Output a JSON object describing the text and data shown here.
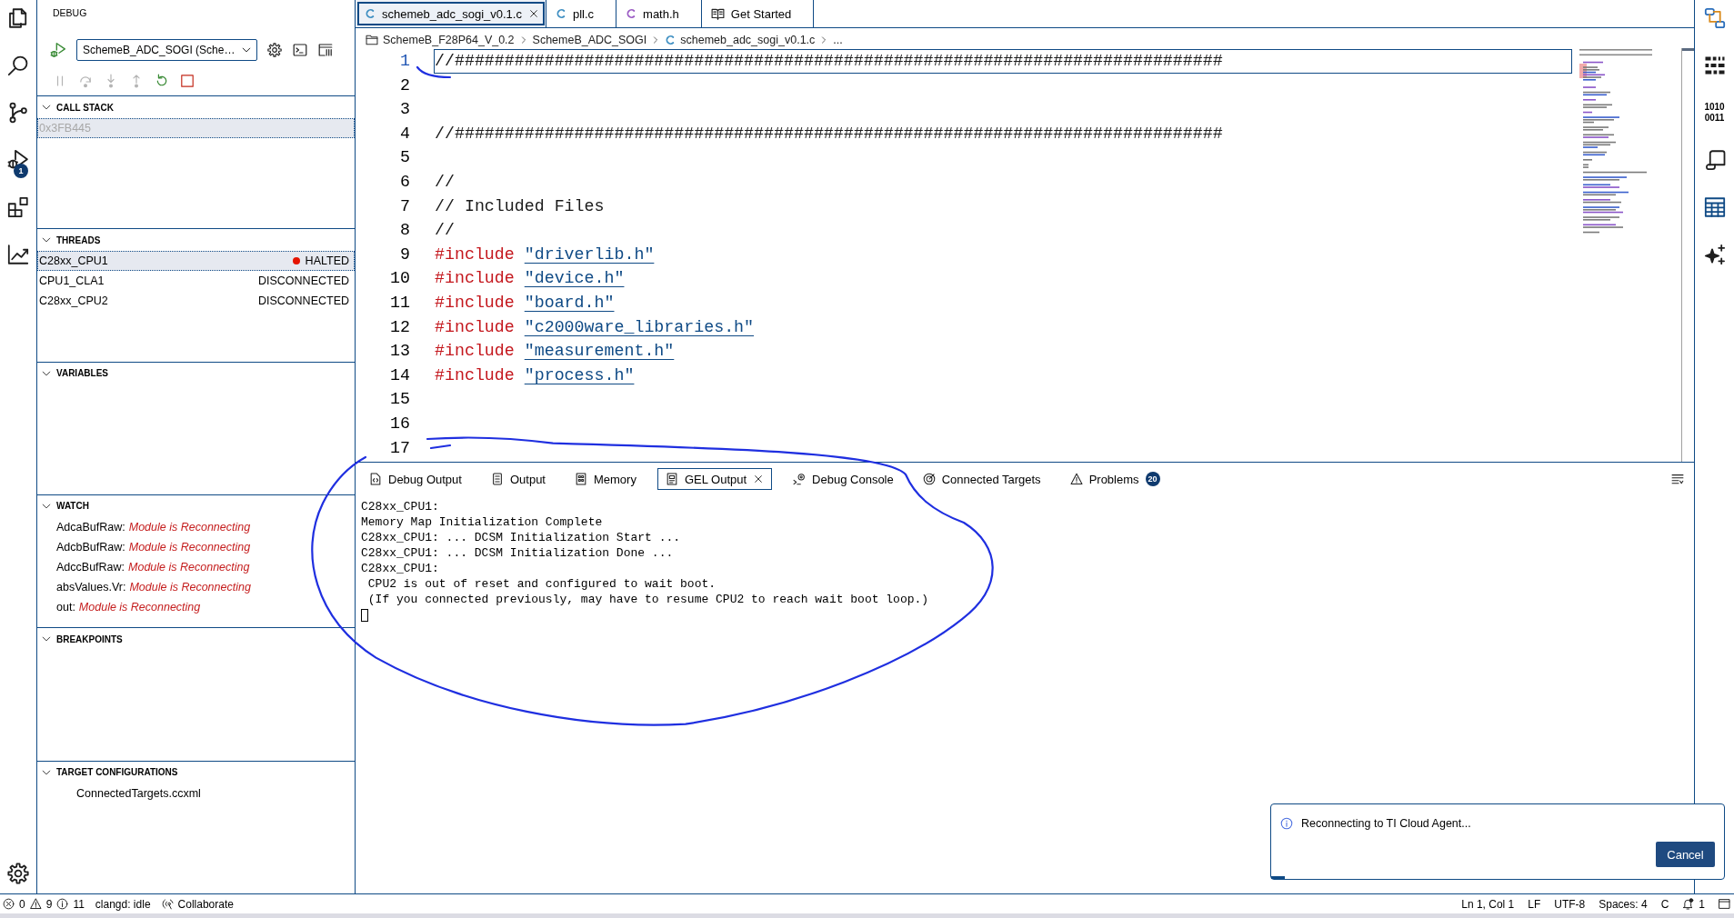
{
  "activity_bar": {
    "debug_badge": "1"
  },
  "sidebar": {
    "title": "DEBUG",
    "launch_config": "SchemeB_ADC_SOGI (Sche…",
    "controls": [
      {
        "disabled": true
      },
      {
        "disabled": true
      },
      {
        "disabled": true
      },
      {
        "disabled": true
      },
      {
        "disabled": false
      },
      {
        "disabled": false
      }
    ],
    "sections": [
      {
        "kind": "call_stack",
        "title": "CALL STACK",
        "expanded": true,
        "rows": [
          {
            "label": "0x3FB445",
            "selected": true,
            "disabled": true
          }
        ]
      },
      {
        "kind": "threads",
        "title": "THREADS",
        "expanded": true,
        "rows": [
          {
            "name": "C28xx_CPU1",
            "status": "HALTED",
            "halted": true,
            "selected": true
          },
          {
            "name": "CPU1_CLA1",
            "status": "DISCONNECTED",
            "halted": false,
            "selected": false
          },
          {
            "name": "C28xx_CPU2",
            "status": "DISCONNECTED",
            "halted": false,
            "selected": false
          }
        ]
      },
      {
        "kind": "variables",
        "title": "VARIABLES",
        "expanded": true
      },
      {
        "kind": "watch",
        "title": "WATCH",
        "expanded": true,
        "rows": [
          {
            "expression": "AdcaBufRaw:",
            "value": "Module is Reconnecting",
            "error": true
          },
          {
            "expression": "AdcbBufRaw:",
            "value": "Module is Reconnecting",
            "error": true
          },
          {
            "expression": "AdccBufRaw:",
            "value": "Module is Reconnecting",
            "error": true
          },
          {
            "expression": "absValues.Vr:",
            "value": "Module is Reconnecting",
            "error": true
          },
          {
            "expression": "out:",
            "value": "Module is Reconnecting",
            "error": true
          }
        ]
      },
      {
        "kind": "breakpoints",
        "title": "BREAKPOINTS",
        "expanded": true
      },
      {
        "kind": "target_configurations",
        "title": "TARGET CONFIGURATIONS",
        "expanded": true,
        "rows": [
          {
            "file": "ConnectedTargets.ccxml"
          }
        ]
      }
    ]
  },
  "editor_tabs": [
    {
      "label": "schemeb_adc_sogi_v0.1.c",
      "kind": "c_source",
      "selected": true
    },
    {
      "label": "pll.c",
      "kind": "c_source",
      "selected": false
    },
    {
      "label": "math.h",
      "kind": "c_header",
      "selected": false
    },
    {
      "label": "Get Started",
      "kind": "welcome",
      "selected": false
    }
  ],
  "breadcrumb": [
    {
      "label": "SchemeB_F28P64_V_0.2",
      "kind": "root_folder"
    },
    {
      "label": "SchemeB_ADC_SOGI",
      "kind": "folder"
    },
    {
      "label": "schemeb_adc_sogi_v0.1.c",
      "kind": "c_file"
    },
    {
      "label": "...",
      "kind": "more"
    }
  ],
  "code_lines": [
    {
      "number": "1",
      "current": true,
      "tokens": [
        {
          "kind": "comment",
          "text": "//#############################################################################"
        }
      ]
    },
    {
      "number": "2",
      "current": false
    },
    {
      "number": "3",
      "current": false
    },
    {
      "number": "4",
      "current": false,
      "tokens": [
        {
          "kind": "comment",
          "text": "//#############################################################################"
        }
      ]
    },
    {
      "number": "5",
      "current": false
    },
    {
      "number": "6",
      "current": false,
      "tokens": [
        {
          "kind": "comment",
          "text": "//"
        }
      ]
    },
    {
      "number": "7",
      "current": false,
      "tokens": [
        {
          "kind": "comment",
          "text": "// Included Files"
        }
      ]
    },
    {
      "number": "8",
      "current": false,
      "tokens": [
        {
          "kind": "comment",
          "text": "//"
        }
      ]
    },
    {
      "number": "9",
      "current": false,
      "tokens": [
        {
          "kind": "directive",
          "text": "#include"
        },
        {
          "kind": "include_path",
          "text": "\"driverlib.h\""
        }
      ]
    },
    {
      "number": "10",
      "current": false,
      "tokens": [
        {
          "kind": "directive",
          "text": "#include"
        },
        {
          "kind": "include_path",
          "text": "\"device.h\""
        }
      ]
    },
    {
      "number": "11",
      "current": false,
      "tokens": [
        {
          "kind": "directive",
          "text": "#include"
        },
        {
          "kind": "include_path",
          "text": "\"board.h\""
        }
      ]
    },
    {
      "number": "12",
      "current": false,
      "tokens": [
        {
          "kind": "directive",
          "text": "#include"
        },
        {
          "kind": "include_path",
          "text": "\"c2000ware_libraries.h\""
        }
      ]
    },
    {
      "number": "13",
      "current": false,
      "tokens": [
        {
          "kind": "directive",
          "text": "#include"
        },
        {
          "kind": "include_path",
          "text": "\"measurement.h\""
        }
      ]
    },
    {
      "number": "14",
      "current": false,
      "tokens": [
        {
          "kind": "directive",
          "text": "#include"
        },
        {
          "kind": "include_path",
          "text": "\"process.h\""
        }
      ]
    },
    {
      "number": "15",
      "current": false
    },
    {
      "number": "16",
      "current": false
    },
    {
      "number": "17",
      "current": false
    }
  ],
  "panel": {
    "tabs": [
      {
        "label": "Debug Output",
        "selected": false
      },
      {
        "label": "Output",
        "selected": false
      },
      {
        "label": "Memory",
        "selected": false
      },
      {
        "label": "GEL Output",
        "selected": true
      },
      {
        "label": "Debug Console",
        "selected": false
      },
      {
        "label": "Connected Targets",
        "selected": false
      },
      {
        "label": "Problems",
        "selected": false,
        "badge": "20"
      }
    ],
    "output_lines": [
      "C28xx_CPU1:",
      "Memory Map Initialization Complete",
      "C28xx_CPU1: ... DCSM Initialization Start ...",
      "C28xx_CPU1: ... DCSM Initialization Done ...",
      "C28xx_CPU1:",
      " CPU2 is out of reset and configured to wait boot.",
      " (If you connected previously, may have to resume CPU2 to reach wait boot loop.)"
    ]
  },
  "notification": {
    "message": "Reconnecting to TI Cloud Agent...",
    "action": "Cancel"
  },
  "right_bar": {
    "binary_label": [
      "1010",
      "0011"
    ]
  },
  "status_bar": {
    "errors": "0",
    "warnings": "9",
    "infos": "11",
    "language_server": "clangd: idle",
    "collaborate": "Collaborate",
    "cursor": "Ln 1, Col 1",
    "eol": "LF",
    "encoding": "UTF-8",
    "indent": "Spaces: 4",
    "language": "C",
    "notifications": "1"
  }
}
